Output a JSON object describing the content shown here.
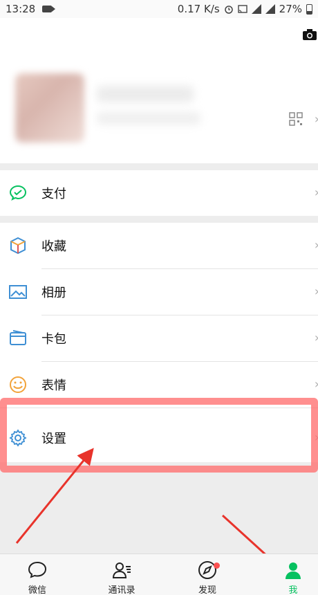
{
  "status_bar": {
    "time": "13:28",
    "network_speed": "0.17 K/s",
    "battery_percent": "27%",
    "battery_level": 0.27
  },
  "profile": {
    "icons": [
      "camera-icon",
      "qr-code-icon",
      "chevron-right-icon"
    ]
  },
  "menu": {
    "pay": {
      "label": "支付",
      "icon": "wechat-pay-icon",
      "color": "#07c160"
    },
    "favorites": {
      "label": "收藏",
      "icon": "cube-icon"
    },
    "album": {
      "label": "相册",
      "icon": "image-icon",
      "color": "#3e8fd4"
    },
    "cards": {
      "label": "卡包",
      "icon": "wallet-icon",
      "color": "#3e8fd4"
    },
    "stickers": {
      "label": "表情",
      "icon": "smiley-icon",
      "color": "#f2a33a"
    },
    "settings": {
      "label": "设置",
      "icon": "gear-icon",
      "color": "#3e8fd4"
    }
  },
  "tabs": [
    {
      "label": "微信",
      "icon": "chat-bubble-icon"
    },
    {
      "label": "通讯录",
      "icon": "contacts-icon"
    },
    {
      "label": "发现",
      "icon": "compass-icon",
      "badge": true
    },
    {
      "label": "我",
      "icon": "person-icon",
      "active": true
    }
  ],
  "colors": {
    "accent": "#07c160",
    "highlight": "#ff6969",
    "arrow": "#e8332b"
  }
}
